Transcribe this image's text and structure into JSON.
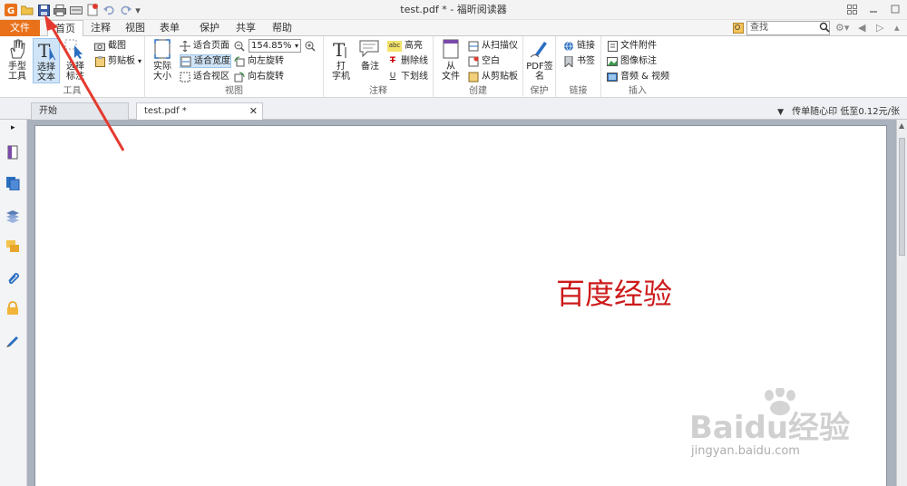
{
  "window": {
    "title": "test.pdf * - 福昕阅读器"
  },
  "quick_access": {
    "icons": [
      "app-logo-icon",
      "open-folder-icon",
      "save-icon",
      "print-icon",
      "scan-icon",
      "new-icon",
      "undo-icon",
      "redo-icon",
      "customize-icon"
    ]
  },
  "ribbon_tabs": {
    "file": "文件",
    "home": "首页",
    "comment": "注释",
    "view": "视图",
    "form": "表单",
    "protect": "保护",
    "share": "共享",
    "help": "帮助"
  },
  "search": {
    "placeholder": "查找"
  },
  "ribbon": {
    "tools": {
      "group_label": "工具",
      "hand": "手型\n工具",
      "select_text": "选择\n文本",
      "select_annot": "选择\n标注",
      "snapshot": "截图",
      "clipboard": "剪贴板"
    },
    "view": {
      "group_label": "视图",
      "actual_size": "实际\n大小",
      "fit_page": "适合页面",
      "fit_width": "适合宽度",
      "fit_visible": "适合视区",
      "zoom_value": "154.85%",
      "rotate_left": "向左旋转",
      "rotate_right": "向右旋转"
    },
    "comment": {
      "group_label": "注释",
      "typewriter": "打\n字机",
      "note": "备注",
      "highlight": "高亮",
      "strikeout": "删除线",
      "underline": "下划线"
    },
    "create": {
      "group_label": "创建",
      "from_file": "从\n文件",
      "from_scanner": "从扫描仪",
      "blank": "空白",
      "from_clipboard": "从剪贴板"
    },
    "protect": {
      "group_label": "保护",
      "pdf_sign": "PDF签\n名"
    },
    "links": {
      "group_label": "链接",
      "link": "链接",
      "bookmark": "书签"
    },
    "insert": {
      "group_label": "插入",
      "file_attachment": "文件附件",
      "image_annotation": "图像标注",
      "audio_video": "音频 & 视频"
    }
  },
  "doc_tabs": {
    "start": "开始",
    "file": "test.pdf *"
  },
  "ad": {
    "text": "传单随心印 低至0.12元/张"
  },
  "document": {
    "text": "百度经验",
    "text_color": "#cc1a1a"
  },
  "watermark": {
    "brand": "Baidu经验",
    "url": "jingyan.baidu.com"
  },
  "colors": {
    "file_tab": "#e8711a",
    "annotation_arrow": "#e53a2f",
    "selected": "#cfe4f7"
  }
}
